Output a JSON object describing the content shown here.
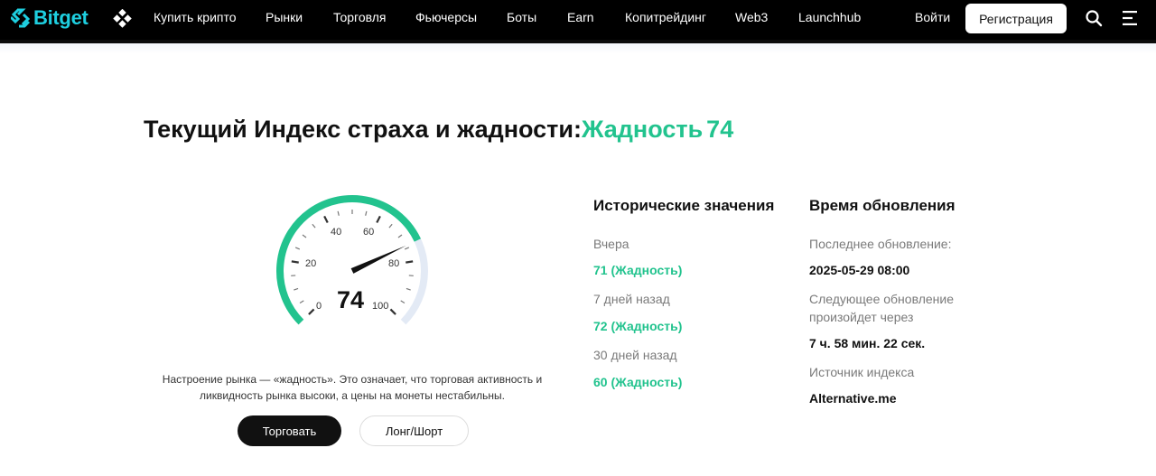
{
  "header": {
    "logo_text": "Bitget",
    "nav": [
      "Купить крипто",
      "Рынки",
      "Торговля",
      "Фьючерсы",
      "Боты",
      "Earn",
      "Копитрейдинг",
      "Web3",
      "Launchhub"
    ],
    "login_label": "Войти",
    "register_label": "Регистрация",
    "icons": {
      "search": "search-icon",
      "menu": "menu-icon",
      "apps": "apps-icon"
    }
  },
  "title": {
    "prefix": "Текущий Индекс страха и жадности:",
    "status": "Жадность",
    "value": "74"
  },
  "gauge": {
    "value": 74,
    "display_value": "74",
    "min": 0,
    "max": 100,
    "labels": [
      "0",
      "20",
      "40",
      "60",
      "80",
      "100"
    ],
    "colors": {
      "active": "#22c38e",
      "inactive": "#e3eaf5",
      "needle": "#111111"
    }
  },
  "mood_text": {
    "line1": "Настроение рынка — «жадность». Это означает, что торговая активность и",
    "line2": "ликвидность рынка высоки, а цены на монеты нестабильны."
  },
  "buttons": {
    "trade": "Торговать",
    "long_short": "Лонг/Шорт"
  },
  "history": {
    "title": "Исторические значения",
    "items": [
      {
        "label": "Вчера",
        "value": "71 (Жадность)"
      },
      {
        "label": "7 дней назад",
        "value": "72 (Жадность)"
      },
      {
        "label": "30 дней назад",
        "value": "60 (Жадность)"
      }
    ]
  },
  "update": {
    "title": "Время обновления",
    "last_label": "Последнее обновление:",
    "last_value": "2025-05-29 08:00",
    "next_label": "Следующее обновление произойдет через",
    "next_value": "7 ч. 58 мин. 22 сек.",
    "source_label": "Источник индекса",
    "source_value": "Alternative.me"
  },
  "colors": {
    "accent": "#22c38e",
    "brand": "#1ecfe0",
    "nav_bg": "#000000"
  }
}
